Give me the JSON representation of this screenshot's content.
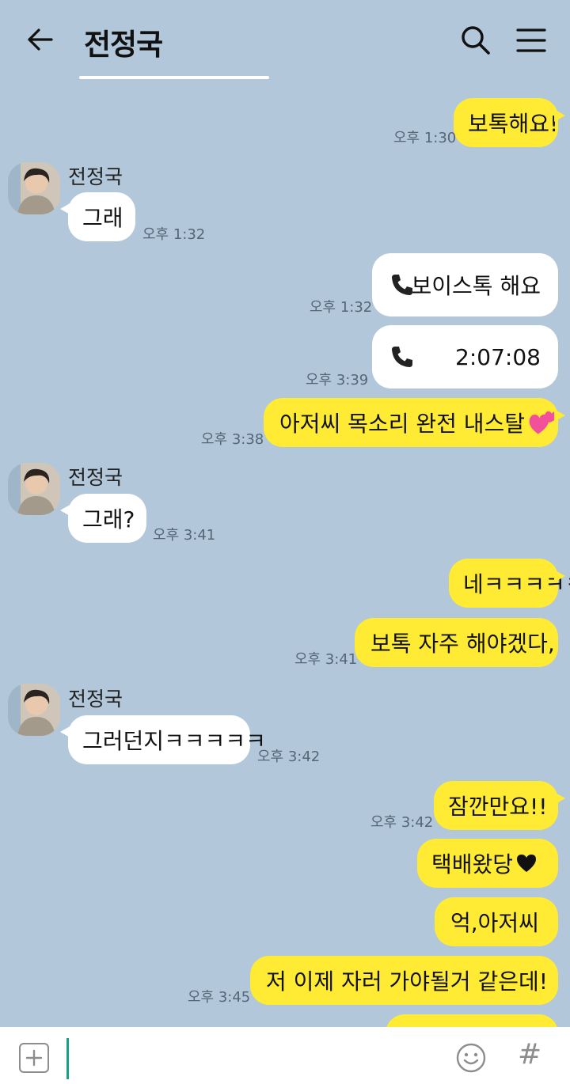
{
  "header": {
    "title": "전정국",
    "back_icon": "arrow-left-icon",
    "search_icon": "search-icon",
    "menu_icon": "hamburger-menu-icon"
  },
  "messages": [
    {
      "text": "보톡해요!",
      "time": "오후 1:30"
    },
    {
      "sender": "전정국",
      "text": "그래",
      "time": "오후 1:32"
    },
    {
      "call_icon": "phone-icon",
      "text": "보이스톡 해요",
      "time": "오후 1:32"
    },
    {
      "call_icon": "phone-icon",
      "text": "2:07:08",
      "time": "오후 3:39"
    },
    {
      "text": "아저씨 목소리 완전 내스탈",
      "emoji_icon": "two-hearts-icon",
      "time": "오후 3:38"
    },
    {
      "sender": "전정국",
      "text": "그래?",
      "time": "오후 3:41"
    },
    {
      "text": "네ㅋㅋㅋㅋㅋ"
    },
    {
      "text": "보톡 자주 해야겠다,",
      "time": "오후 3:41"
    },
    {
      "sender": "전정국",
      "text": "그러던지ㅋㅋㅋㅋㅋ",
      "time": "오후 3:42"
    },
    {
      "text": "잠깐만요!!",
      "time": "오후 3:42"
    },
    {
      "text": "택배왔당",
      "emoji_icon": "black-heart-icon"
    },
    {
      "text": "억,아저씨"
    },
    {
      "text": "저 이제 자러 가야될거 같은데!",
      "time": "오후 3:45"
    }
  ],
  "input_bar": {
    "plus_icon": "plus-square-icon",
    "emoji_icon": "smiley-icon",
    "hash_label": "#"
  },
  "colors": {
    "background": "#b2c7d9",
    "outgoing_bubble": "#ffeb33",
    "incoming_bubble": "#ffffff"
  }
}
